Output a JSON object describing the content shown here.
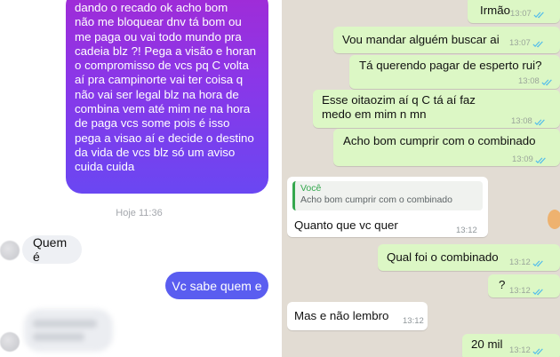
{
  "left_panel": {
    "sent_message": "dando o recado ok acho bom\nnão me bloquear dnv tá bom ou\nme paga ou vai todo mundo pra\ncadeia blz ?! Pega a visão e horan\no compromisso de vcs pq C volta\naí pra campinorte vai ter coisa q\nnão vai ser legal blz na hora de\ncombina vem até mim ne na hora\nde paga vcs some pois é isso\npega a visao aí e decide o destino\nda vida de vcs blz só um aviso\ncuida cuida",
    "timestamp": "Hoje 11:36",
    "received_1": "Quem é",
    "sent_2": "Vc sabe quem e",
    "colors": {
      "gradient_top": "#a12bd6",
      "gradient_bottom": "#6a47f2",
      "sent_blue": "#5a5df0",
      "received_bg": "#eef0f4"
    }
  },
  "right_panel": {
    "messages": [
      {
        "id": "m1",
        "direction": "out",
        "text": "Irmão",
        "time": "13:07"
      },
      {
        "id": "m2",
        "direction": "out",
        "text": "Vou mandar alguém buscar ai",
        "time": "13:07"
      },
      {
        "id": "m3",
        "direction": "out",
        "text": "Tá querendo pagar de esperto rui?",
        "time": "13:08"
      },
      {
        "id": "m4",
        "direction": "out",
        "text": "Esse oitaozim aí q C tá aí faz medo em mim n mn",
        "time": "13:08"
      },
      {
        "id": "m5",
        "direction": "out",
        "text": "Acho bom cumprir com o combinado",
        "time": "13:09"
      },
      {
        "id": "m6",
        "direction": "in",
        "quote_author": "Você",
        "quote_text": "Acho bom cumprir com o combinado",
        "text": "Quanto que vc quer",
        "time": "13:12"
      },
      {
        "id": "m7",
        "direction": "out",
        "text": "Qual foi o combinado",
        "time": "13:12"
      },
      {
        "id": "m8",
        "direction": "out",
        "text": "?",
        "time": "13:12"
      },
      {
        "id": "m9",
        "direction": "in",
        "text": "Mas e não lembro",
        "time": "13:12"
      },
      {
        "id": "m10",
        "direction": "out",
        "text": "20 mil",
        "time": "13:12"
      }
    ],
    "colors": {
      "background": "#e2dcd3",
      "outgoing": "#dcf7c5",
      "incoming": "#ffffff",
      "tick": "#53bdeb",
      "quote_accent": "#35a84e"
    }
  }
}
